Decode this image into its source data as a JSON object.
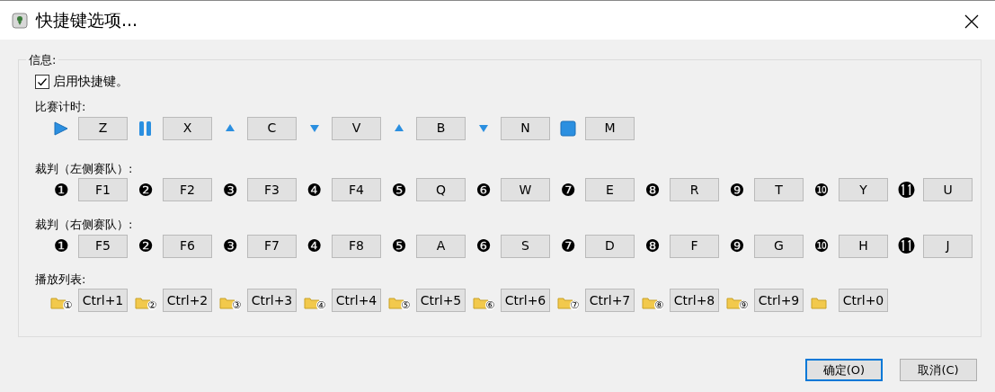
{
  "window": {
    "title": "快捷键选项..."
  },
  "group": {
    "title": "信息:"
  },
  "enable": {
    "label": "启用快捷键。",
    "checked": true
  },
  "sections": [
    {
      "title": "比赛计时:",
      "items": [
        {
          "kind": "play",
          "key": "Z"
        },
        {
          "kind": "pause",
          "key": "X"
        },
        {
          "kind": "up",
          "key": "C"
        },
        {
          "kind": "down",
          "key": "V"
        },
        {
          "kind": "up",
          "key": "B"
        },
        {
          "kind": "down",
          "key": "N"
        },
        {
          "kind": "stop",
          "key": "M"
        }
      ]
    },
    {
      "title": "裁判（左侧赛队）:",
      "items": [
        {
          "kind": "number",
          "mark": "❶",
          "key": "F1"
        },
        {
          "kind": "number",
          "mark": "❷",
          "key": "F2"
        },
        {
          "kind": "number",
          "mark": "❸",
          "key": "F3"
        },
        {
          "kind": "number",
          "mark": "❹",
          "key": "F4"
        },
        {
          "kind": "number",
          "mark": "❺",
          "key": "Q"
        },
        {
          "kind": "number",
          "mark": "❻",
          "key": "W"
        },
        {
          "kind": "number",
          "mark": "❼",
          "key": "E"
        },
        {
          "kind": "number",
          "mark": "❽",
          "key": "R"
        },
        {
          "kind": "number",
          "mark": "❾",
          "key": "T"
        },
        {
          "kind": "number",
          "mark": "❿",
          "key": "Y"
        },
        {
          "kind": "number",
          "mark": "⓫",
          "key": "U"
        }
      ]
    },
    {
      "title": "裁判（右侧赛队）:",
      "items": [
        {
          "kind": "number",
          "mark": "❶",
          "key": "F5"
        },
        {
          "kind": "number",
          "mark": "❷",
          "key": "F6"
        },
        {
          "kind": "number",
          "mark": "❸",
          "key": "F7"
        },
        {
          "kind": "number",
          "mark": "❹",
          "key": "F8"
        },
        {
          "kind": "number",
          "mark": "❺",
          "key": "A"
        },
        {
          "kind": "number",
          "mark": "❻",
          "key": "S"
        },
        {
          "kind": "number",
          "mark": "❼",
          "key": "D"
        },
        {
          "kind": "number",
          "mark": "❽",
          "key": "F"
        },
        {
          "kind": "number",
          "mark": "❾",
          "key": "G"
        },
        {
          "kind": "number",
          "mark": "❿",
          "key": "H"
        },
        {
          "kind": "number",
          "mark": "⓫",
          "key": "J"
        }
      ]
    },
    {
      "title": "播放列表:",
      "items": [
        {
          "kind": "playlist",
          "mark": "①",
          "key": "Ctrl+1"
        },
        {
          "kind": "playlist",
          "mark": "②",
          "key": "Ctrl+2"
        },
        {
          "kind": "playlist",
          "mark": "③",
          "key": "Ctrl+3"
        },
        {
          "kind": "playlist",
          "mark": "④",
          "key": "Ctrl+4"
        },
        {
          "kind": "playlist",
          "mark": "⑤",
          "key": "Ctrl+5"
        },
        {
          "kind": "playlist",
          "mark": "⑥",
          "key": "Ctrl+6"
        },
        {
          "kind": "playlist",
          "mark": "⑦",
          "key": "Ctrl+7"
        },
        {
          "kind": "playlist",
          "mark": "⑧",
          "key": "Ctrl+8"
        },
        {
          "kind": "playlist",
          "mark": "⑨",
          "key": "Ctrl+9"
        },
        {
          "kind": "folder",
          "key": "Ctrl+0"
        }
      ]
    }
  ],
  "buttons": [
    {
      "label": "确定(O)",
      "default": true
    },
    {
      "label": "取消(C)",
      "default": false
    }
  ]
}
